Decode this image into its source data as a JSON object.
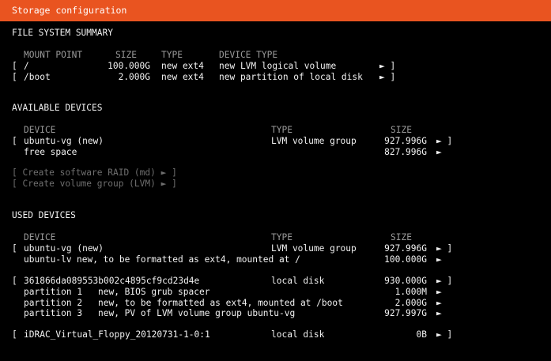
{
  "window": {
    "title": "Storage configuration"
  },
  "fs_summary": {
    "heading": "FILE SYSTEM SUMMARY",
    "headers": {
      "mount": "MOUNT POINT",
      "size": "SIZE",
      "type": "TYPE",
      "device_type": "DEVICE TYPE"
    },
    "rows": [
      {
        "bracket": "[",
        "mount": "/",
        "size": "100.000G",
        "type": "new ext4",
        "device_type": "new LVM logical volume",
        "action": "► ]"
      },
      {
        "bracket": "[",
        "mount": "/boot",
        "size": "2.000G",
        "type": "new ext4",
        "device_type": "new partition of local disk",
        "action": "► ]"
      }
    ]
  },
  "available": {
    "heading": "AVAILABLE DEVICES",
    "headers": {
      "device": "DEVICE",
      "type": "TYPE",
      "size": "SIZE"
    },
    "rows": [
      {
        "bracket": "[",
        "device": "ubuntu-vg (new)",
        "type": "LVM volume group",
        "size": "927.996G",
        "action": "► ]"
      },
      {
        "device": "free space",
        "size": "827.996G",
        "action": "►"
      }
    ],
    "actions": [
      "[ Create software RAID (md) ► ]",
      "[ Create volume group (LVM) ► ]"
    ]
  },
  "used": {
    "heading": "USED DEVICES",
    "headers": {
      "device": "DEVICE",
      "type": "TYPE",
      "size": "SIZE"
    },
    "vg": {
      "bracket": "[",
      "device": "ubuntu-vg (new)",
      "type": "LVM volume group",
      "size": "927.996G",
      "action": "► ]",
      "lv": {
        "name": "ubuntu-lv",
        "desc": "new, to be formatted as ext4, mounted at /",
        "size": "100.000G",
        "action": "►"
      }
    },
    "disk": {
      "bracket": "[",
      "device": "361866da089553b002c4895cf9cd23d4e",
      "type": "local disk",
      "size": "930.000G",
      "action": "► ]",
      "partitions": [
        {
          "name": "partition 1",
          "desc": "new, BIOS grub spacer",
          "size": "1.000M",
          "action": "►"
        },
        {
          "name": "partition 2",
          "desc": "new, to be formatted as ext4, mounted at /boot",
          "size": "2.000G",
          "action": "►"
        },
        {
          "name": "partition 3",
          "desc": "new, PV of LVM volume group ubuntu-vg",
          "size": "927.997G",
          "action": "►"
        }
      ]
    },
    "floppy": {
      "bracket": "[",
      "device": "iDRAC_Virtual_Floppy_20120731-1-0:1",
      "type": "local disk",
      "size": "0B",
      "action": "► ]"
    }
  }
}
